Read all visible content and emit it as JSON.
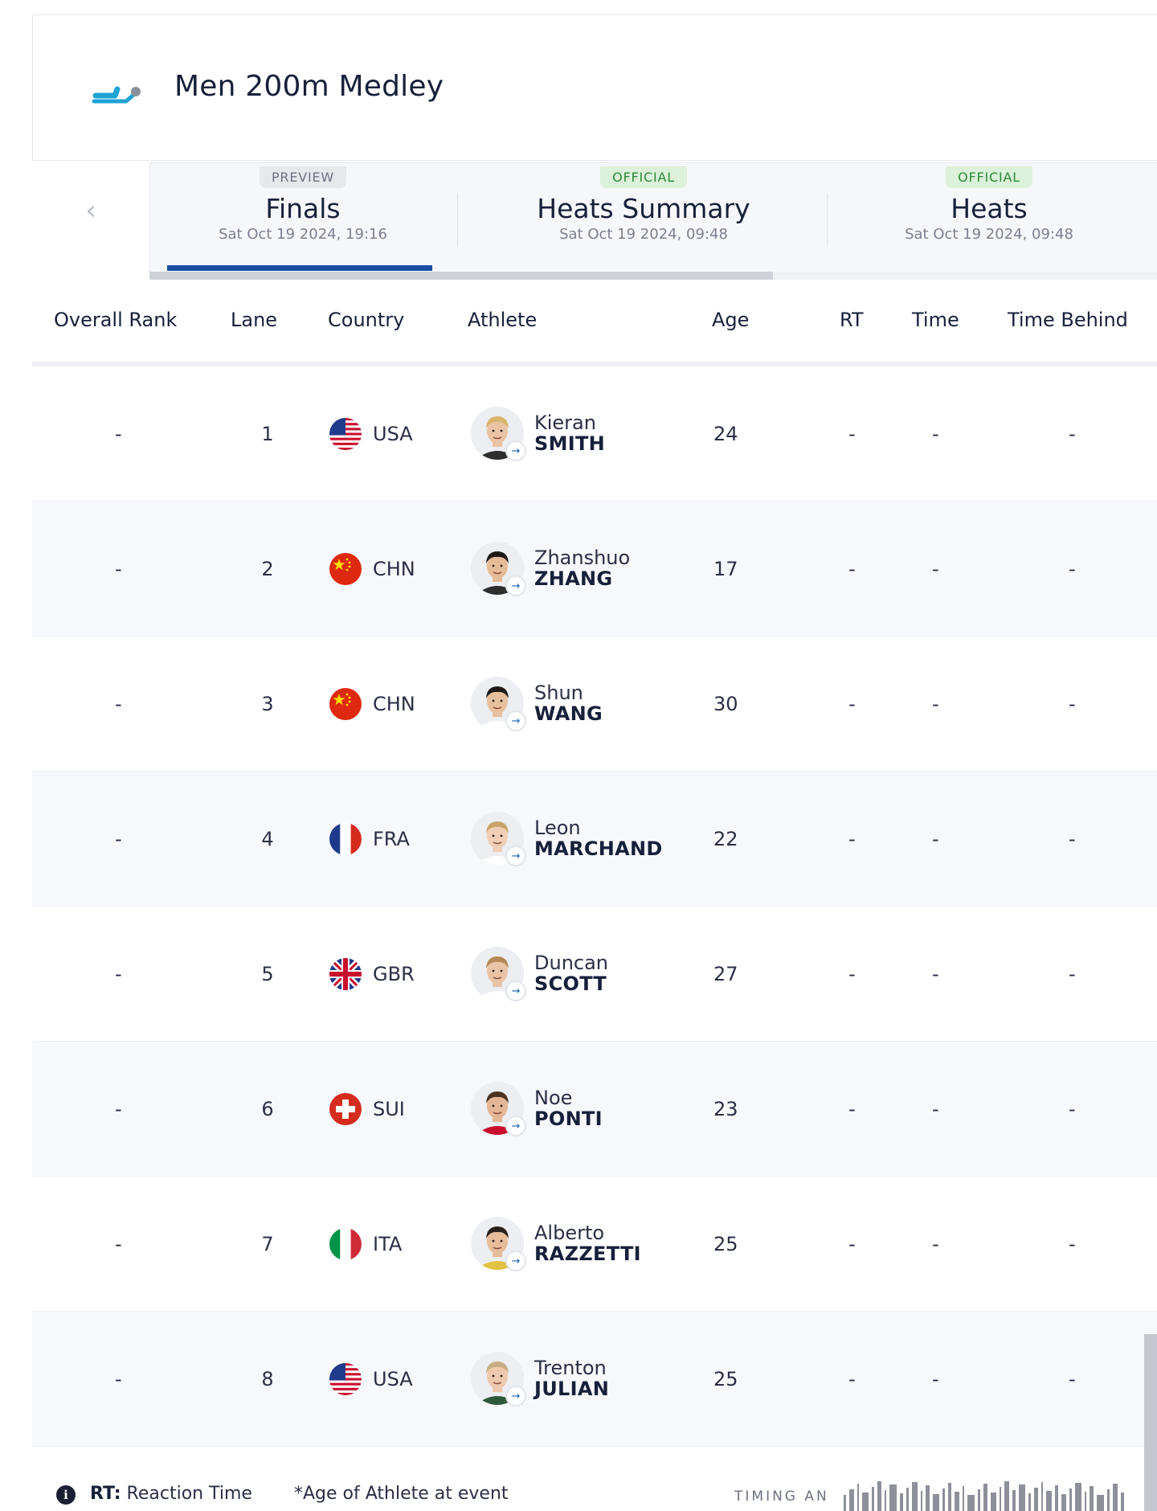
{
  "event": {
    "title": "Men 200m Medley",
    "icon": "swimmer-icon",
    "icon_color": "#1ea3d6"
  },
  "tabs": [
    {
      "badge": "PREVIEW",
      "name": "Finals",
      "date": "Sat Oct 19 2024, 19:16",
      "active": true
    },
    {
      "badge": "OFFICIAL",
      "name": "Heats Summary",
      "date": "Sat Oct 19 2024, 09:48",
      "active": false
    },
    {
      "badge": "OFFICIAL",
      "name": "Heats",
      "date": "Sat Oct 19 2024, 09:48",
      "active": false
    }
  ],
  "table": {
    "headers": {
      "rank": "Overall Rank",
      "lane": "Lane",
      "country": "Country",
      "athlete": "Athlete",
      "age": "Age",
      "rt": "RT",
      "time": "Time",
      "behind": "Time Behind"
    },
    "rows": [
      {
        "rank": "-",
        "lane": "1",
        "flag": "usa",
        "country": "USA",
        "first": "Kieran",
        "last": "SMITH",
        "age": "24",
        "rt": "-",
        "time": "-",
        "behind": "-"
      },
      {
        "rank": "-",
        "lane": "2",
        "flag": "chn",
        "country": "CHN",
        "first": "Zhanshuo",
        "last": "ZHANG",
        "age": "17",
        "rt": "-",
        "time": "-",
        "behind": "-"
      },
      {
        "rank": "-",
        "lane": "3",
        "flag": "chn",
        "country": "CHN",
        "first": "Shun",
        "last": "WANG",
        "age": "30",
        "rt": "-",
        "time": "-",
        "behind": "-"
      },
      {
        "rank": "-",
        "lane": "4",
        "flag": "fra",
        "country": "FRA",
        "first": "Leon",
        "last": "MARCHAND",
        "age": "22",
        "rt": "-",
        "time": "-",
        "behind": "-"
      },
      {
        "rank": "-",
        "lane": "5",
        "flag": "gbr",
        "country": "GBR",
        "first": "Duncan",
        "last": "SCOTT",
        "age": "27",
        "rt": "-",
        "time": "-",
        "behind": "-"
      },
      {
        "rank": "-",
        "lane": "6",
        "flag": "sui",
        "country": "SUI",
        "first": "Noe",
        "last": "PONTI",
        "age": "23",
        "rt": "-",
        "time": "-",
        "behind": "-"
      },
      {
        "rank": "-",
        "lane": "7",
        "flag": "ita",
        "country": "ITA",
        "first": "Alberto",
        "last": "RAZZETTI",
        "age": "25",
        "rt": "-",
        "time": "-",
        "behind": "-"
      },
      {
        "rank": "-",
        "lane": "8",
        "flag": "usa",
        "country": "USA",
        "first": "Trenton",
        "last": "JULIAN",
        "age": "25",
        "rt": "-",
        "time": "-",
        "behind": "-"
      }
    ]
  },
  "footer": {
    "rt_abbr": "RT:",
    "rt_text": " Reaction Time",
    "age_note": "*Age of Athlete at event",
    "timing": "TIMING AN"
  },
  "colors": {
    "accent": "#1750a5",
    "official_badge": "#dbf1d9",
    "preview_badge": "#e7e8ec"
  }
}
